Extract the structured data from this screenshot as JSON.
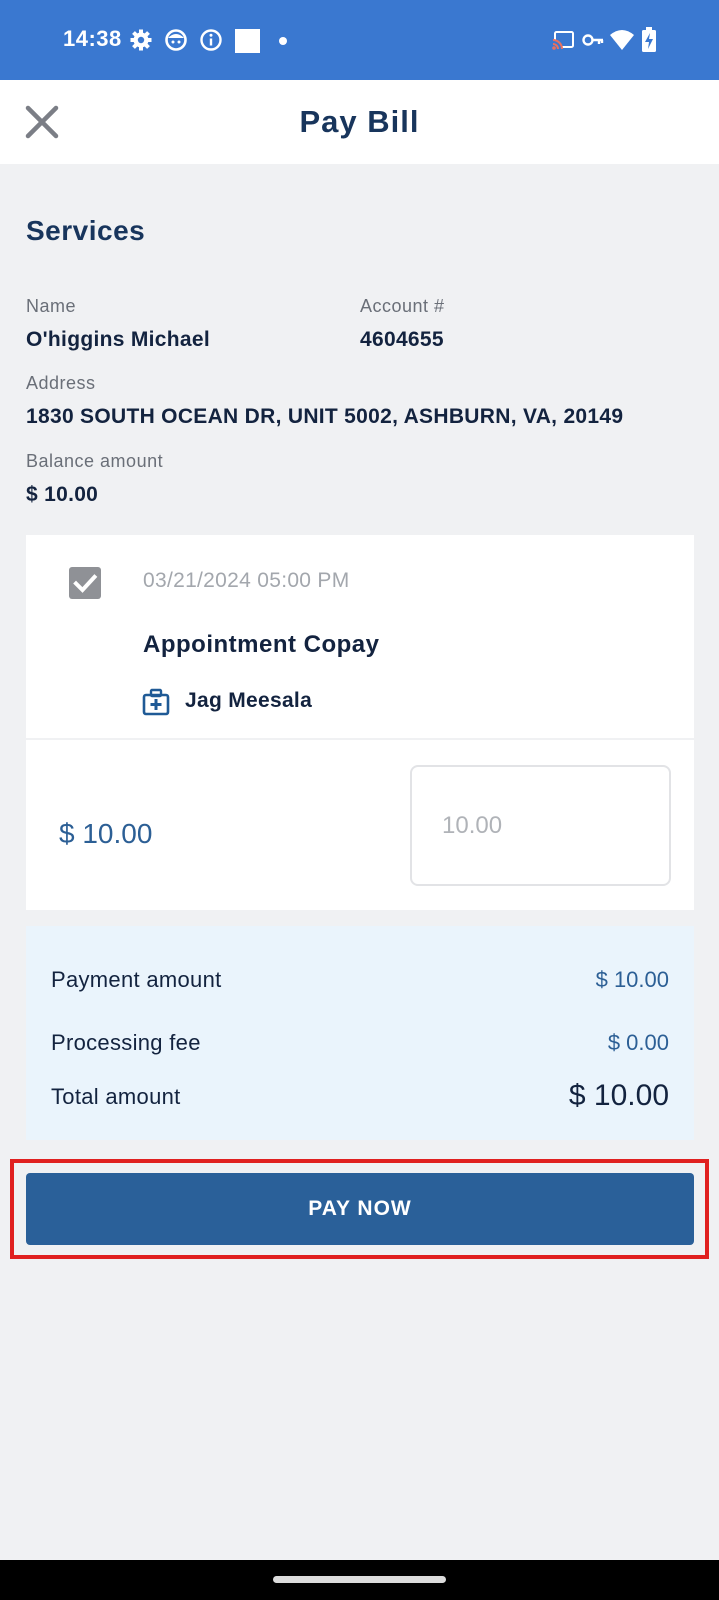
{
  "status_bar": {
    "time": "14:38",
    "left_icons": [
      "settings-icon",
      "face-icon",
      "info-icon",
      "square-icon",
      "dot-icon"
    ],
    "right_icons": [
      "cast-icon",
      "vpn-key-icon",
      "wifi-icon",
      "battery-charging-icon"
    ]
  },
  "header": {
    "title": "Pay Bill",
    "close_icon": "close-icon"
  },
  "services": {
    "title": "Services",
    "name_label": "Name",
    "name_value": "O'higgins Michael",
    "account_label": "Account #",
    "account_value": "4604655",
    "address_label": "Address",
    "address_value": "1830 SOUTH OCEAN DR, UNIT 5002, ASHBURN, VA, 20149",
    "balance_label": "Balance amount",
    "balance_value": "$ 10.00"
  },
  "bill_item": {
    "checked": true,
    "date": "03/21/2024 05:00 PM",
    "title": "Appointment Copay",
    "provider": "Jag Meesala",
    "provider_icon": "medical-kit-icon",
    "amount": "$ 10.00",
    "input_placeholder": "10.00"
  },
  "summary": {
    "payment_label": "Payment amount",
    "payment_value": "$ 10.00",
    "fee_label": "Processing fee",
    "fee_value": "$ 0.00",
    "total_label": "Total amount",
    "total_value": "$ 10.00"
  },
  "actions": {
    "pay_now_label": "PAY NOW"
  },
  "colors": {
    "status_bar": "#3a78d0",
    "primary": "#2a6099",
    "highlight": "#e02020",
    "summary_bg": "#eaf4fc"
  }
}
